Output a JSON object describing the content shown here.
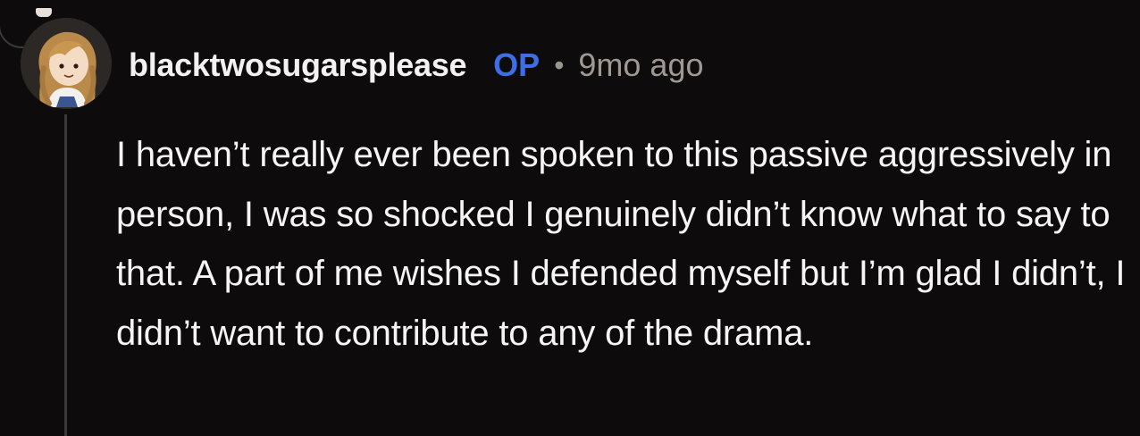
{
  "comment": {
    "author": "blacktwosugarsplease",
    "op_badge": "OP",
    "separator": "•",
    "timestamp": "9mo ago",
    "body": "I haven’t really ever been spoken to this passive aggressively in person, I was so shocked I genuinely didn’t know what to say to that. A part of me wishes I defended myself but I’m glad I didn’t, I didn’t want to contribute to any of the drama."
  },
  "colors": {
    "background": "#0d0b0b",
    "op_badge": "#3c6ee6",
    "meta_text": "#9f9893",
    "thread_line": "#3a3a3a"
  },
  "icons": {
    "avatar": "user-avatar-icon"
  }
}
